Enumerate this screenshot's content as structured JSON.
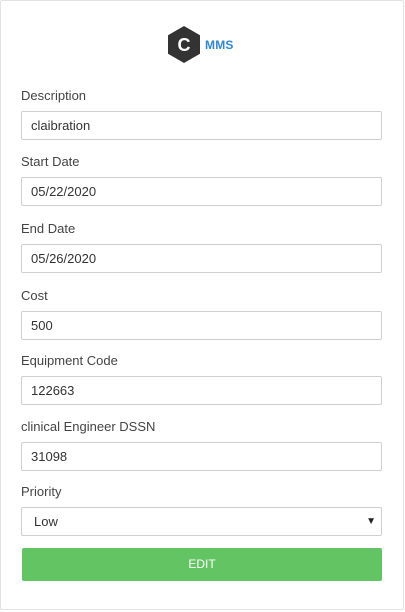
{
  "brand": {
    "logo_letter": "C",
    "logo_text": "MMS",
    "logo_color": "#333333",
    "text_color": "#2f86d8"
  },
  "form": {
    "description": {
      "label": "Description",
      "value": "claibration"
    },
    "start_date": {
      "label": "Start Date",
      "value": "05/22/2020"
    },
    "end_date": {
      "label": "End Date",
      "value": "05/26/2020"
    },
    "cost": {
      "label": "Cost",
      "value": "500"
    },
    "equipment_code": {
      "label": "Equipment Code",
      "value": "122663"
    },
    "engineer_dssn": {
      "label": "clinical Engineer DSSN",
      "value": "31098"
    },
    "priority": {
      "label": "Priority",
      "value": "Low",
      "arrow_icon": "caret-down-icon"
    }
  },
  "actions": {
    "edit_label": "EDIT",
    "edit_color": "#62c462"
  }
}
